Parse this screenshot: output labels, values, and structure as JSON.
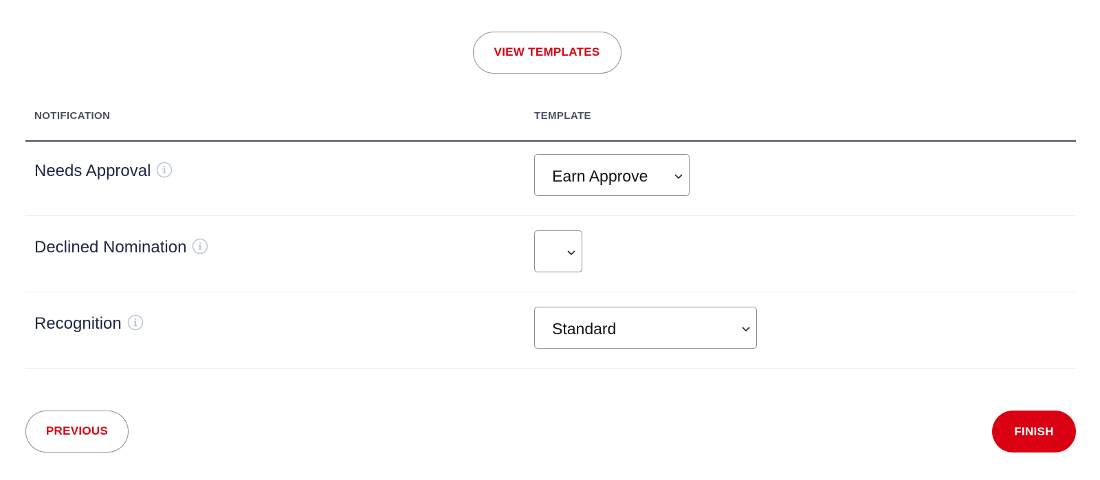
{
  "header": {
    "view_templates_label": "VIEW TEMPLATES"
  },
  "table": {
    "columns": {
      "notification": "NOTIFICATION",
      "template": "TEMPLATE"
    },
    "rows": [
      {
        "label": "Needs Approval",
        "template_value": "Earn Approve",
        "info_icon": "info-icon"
      },
      {
        "label": "Declined Nomination",
        "template_value": "",
        "info_icon": "info-icon"
      },
      {
        "label": "Recognition",
        "template_value": "Standard",
        "info_icon": "info-icon"
      }
    ]
  },
  "footer": {
    "previous_label": "PREVIOUS",
    "finish_label": "FINISH"
  },
  "colors": {
    "accent_red": "#d90012",
    "text_dark": "#1f2544",
    "header_gray": "#4a4f63",
    "border_gray": "#8a8c99",
    "info_icon": "#b8c4dc"
  }
}
